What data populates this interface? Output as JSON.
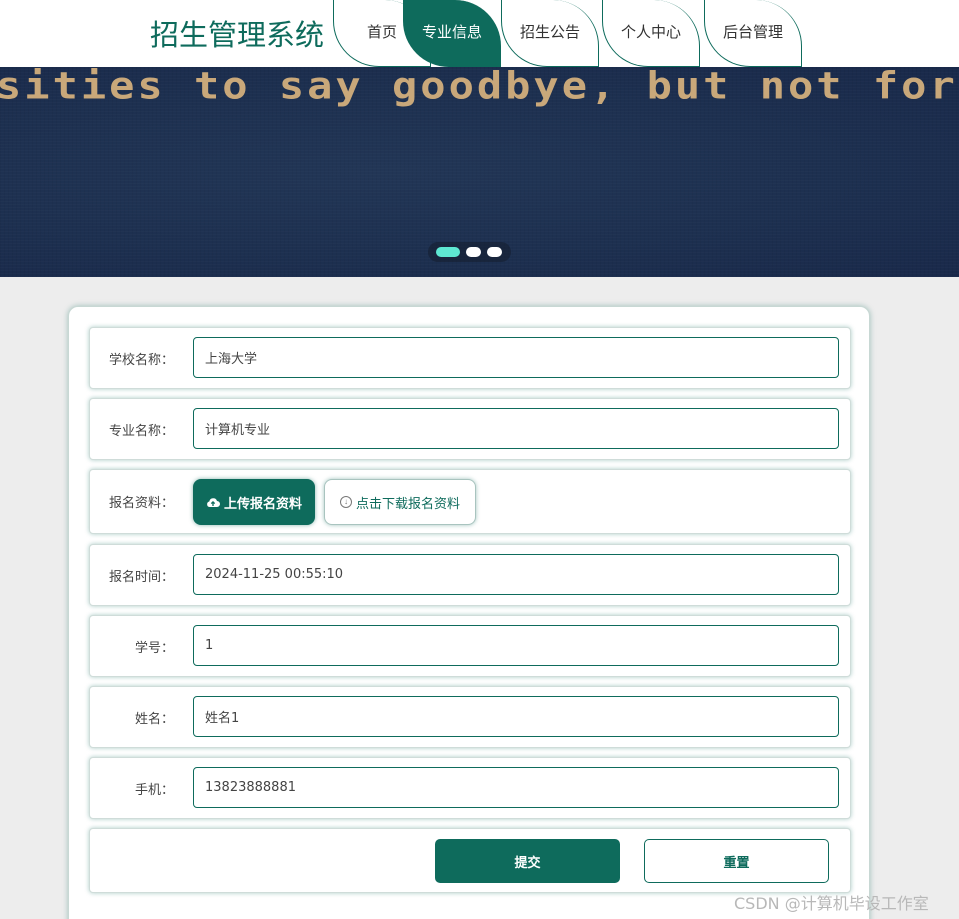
{
  "header": {
    "title": "招生管理系统",
    "nav": [
      {
        "label": "首页",
        "active": false
      },
      {
        "label": "专业信息",
        "active": true
      },
      {
        "label": "招生公告",
        "active": false
      },
      {
        "label": "个人中心",
        "active": false
      },
      {
        "label": "后台管理",
        "active": false
      }
    ]
  },
  "banner": {
    "text": "sities to say goodbye, but not forewell with",
    "active_slide": 1,
    "slide_count": 3
  },
  "form": {
    "school_name": {
      "label": "学校名称：",
      "value": "上海大学"
    },
    "major_name": {
      "label": "专业名称：",
      "value": "计算机专业"
    },
    "materials": {
      "label": "报名资料：",
      "upload_label": "上传报名资料",
      "download_label": "点击下载报名资料"
    },
    "signup_time": {
      "label": "报名时间：",
      "value": "2024-11-25 00:55:10"
    },
    "student_no": {
      "label": "学号：",
      "value": "1"
    },
    "name": {
      "label": "姓名：",
      "value": "姓名1"
    },
    "phone": {
      "label": "手机：",
      "value": "13823888881"
    },
    "submit_label": "提交",
    "reset_label": "重置"
  },
  "watermark": "CSDN @计算机毕设工作室",
  "colors": {
    "primary": "#0e6b5c",
    "dot_active": "#5ee8d2",
    "banner_bg": "#1d3050"
  }
}
